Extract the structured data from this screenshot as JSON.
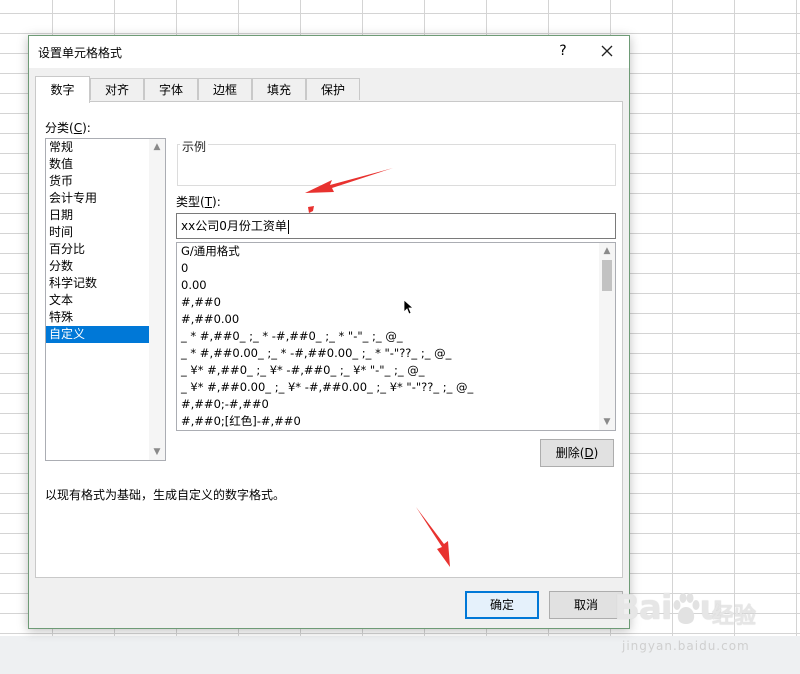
{
  "dialog": {
    "title": "设置单元格格式",
    "help_label": "?"
  },
  "tabs": [
    {
      "label": "数字",
      "active": true
    },
    {
      "label": "对齐",
      "active": false
    },
    {
      "label": "字体",
      "active": false
    },
    {
      "label": "边框",
      "active": false
    },
    {
      "label": "填充",
      "active": false
    },
    {
      "label": "保护",
      "active": false
    }
  ],
  "category": {
    "label": "分类(",
    "label_key": "C",
    "label_end": "):",
    "items": [
      "常规",
      "数值",
      "货币",
      "会计专用",
      "日期",
      "时间",
      "百分比",
      "分数",
      "科学记数",
      "文本",
      "特殊",
      "自定义"
    ],
    "selected": "自定义"
  },
  "sample": {
    "label": "示例"
  },
  "type": {
    "label": "类型(",
    "label_key": "T",
    "label_end": "):",
    "value": "xx公司0月份工资单"
  },
  "formats": [
    "G/通用格式",
    "0",
    "0.00",
    "#,##0",
    "#,##0.00",
    "_ * #,##0_ ;_ * -#,##0_ ;_ * \"-\"_ ;_ @_",
    "_ * #,##0.00_ ;_ * -#,##0.00_ ;_ * \"-\"??_ ;_ @_",
    "_ ¥* #,##0_ ;_ ¥* -#,##0_ ;_ ¥* \"-\"_ ;_ @_",
    "_ ¥* #,##0.00_ ;_ ¥* -#,##0.00_ ;_ ¥* \"-\"??_ ;_ @_",
    "#,##0;-#,##0",
    "#,##0;[红色]-#,##0"
  ],
  "buttons": {
    "delete_label": "删除(",
    "delete_key": "D",
    "delete_end": ")",
    "ok_label": "确定",
    "cancel_label": "取消"
  },
  "description": "以现有格式为基础，生成自定义的数字格式。",
  "watermark": {
    "main": "Bai",
    "main_end": "u",
    "cn": "经验",
    "sub": "jingyan.baidu.com"
  },
  "colors": {
    "selection": "#0078d7",
    "annotation_arrow": "#e8322f",
    "dialog_border": "#6e9b76"
  }
}
